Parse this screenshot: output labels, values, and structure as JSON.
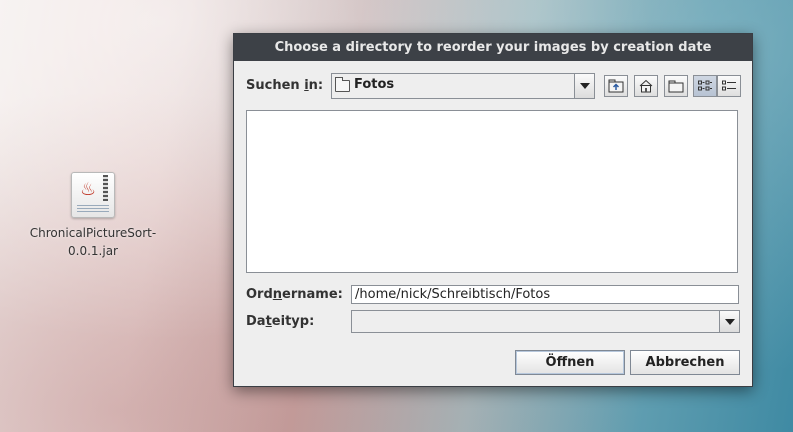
{
  "desktop": {
    "icon_label_line1": "ChronicalPictureSort-",
    "icon_label_line2": "0.0.1.jar"
  },
  "dialog": {
    "title": "Choose a directory to reorder your images by creation date",
    "look_in": {
      "label_pre": "Suchen ",
      "label_mnemonic": "i",
      "label_post": "n:",
      "value": "Fotos"
    },
    "toolbar": {
      "icons": [
        "up-folder-icon",
        "home-icon",
        "new-folder-icon",
        "list-view-icon",
        "details-view-icon"
      ]
    },
    "folder_name": {
      "label_pre": "Ord",
      "label_mnemonic": "n",
      "label_post": "ername:",
      "value": "/home/nick/Schreibtisch/Fotos"
    },
    "file_type": {
      "label_pre": "Da",
      "label_mnemonic": "t",
      "label_post": "eityp:",
      "value": ""
    },
    "buttons": {
      "open": "Öffnen",
      "cancel": "Abbrechen"
    }
  }
}
